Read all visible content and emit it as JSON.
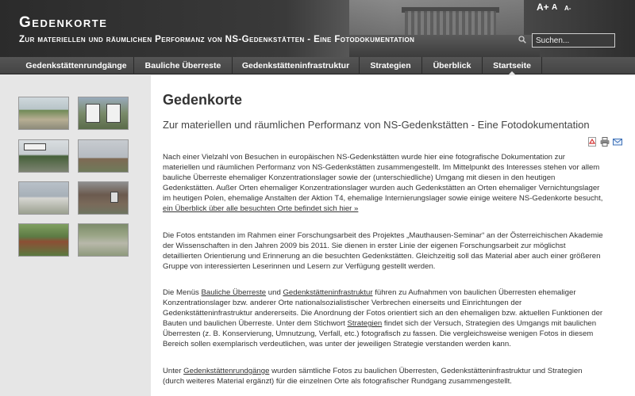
{
  "header": {
    "title": "Gedenkorte",
    "subtitle": "Zur materiellen und räumlichen Performanz von NS-Gedenkstätten - Eine Fotodokumentation",
    "font_size_controls": [
      "A+",
      "A",
      "A-"
    ],
    "search_placeholder": "Suchen..."
  },
  "nav": {
    "items": [
      {
        "label": "Gedenkstättenrundgänge",
        "active": false
      },
      {
        "label": "Bauliche Überreste",
        "active": false
      },
      {
        "label": "Gedenkstätteninfrastruktur",
        "active": false
      },
      {
        "label": "Strategien",
        "active": false
      },
      {
        "label": "Überblick",
        "active": false
      },
      {
        "label": "Startseite",
        "active": true
      }
    ]
  },
  "sidebar": {
    "thumbnails": [
      "photo-1",
      "photo-2",
      "photo-3",
      "photo-4",
      "photo-5",
      "photo-6",
      "photo-7",
      "photo-8"
    ]
  },
  "main": {
    "title": "Gedenkorte",
    "subtitle": "Zur materiellen und räumlichen Performanz von NS-Gedenkstätten - Eine Fotodokumentation",
    "tools": [
      "pdf-icon",
      "print-icon",
      "email-icon"
    ],
    "p1_text": "Nach einer Vielzahl von Besuchen in europäischen NS-Gedenkstätten wurde hier eine fotografische Dokumentation zur materiellen und räumlichen Performanz von NS-Gedenkstätten zusammengestellt. Im Mittelpunkt des Interesses stehen vor allem bauliche Überreste ehemaliger Konzentrationslager sowie der (unterschiedliche) Umgang mit diesen in den heutigen Gedenkstätten. Außer Orten ehemaliger Konzentrationslager wurden auch Gedenkstätten an Orten ehemaliger Vernichtungslager im heutigen Polen, ehemalige Anstalten der Aktion T4, ehemalige Internierungslager sowie einige weitere NS-Gedenkorte besucht, ",
    "p1_link": "ein Überblick über alle besuchten Orte befindet sich hier »",
    "p2_text": "Die Fotos entstanden im Rahmen einer Forschungsarbeit des Projektes „Mauthausen-Seminar“ an der Österreichischen Akademie der Wissenschaften in den Jahren 2009 bis 2011. Sie dienen in erster Linie der eigenen Forschungsarbeit zur möglichst detaillierten Orientierung und Erinnerung an die besuchten Gedenkstätten. Gleichzeitig soll das Material aber auch einer größeren Gruppe von interessierten Leserinnen und Lesern zur Verfügung gestellt werden.",
    "p3_a": "Die Menüs ",
    "p3_link1": "Bauliche Überreste",
    "p3_b": " und ",
    "p3_link2": "Gedenkstätteninfrastruktur",
    "p3_c": " führen zu Aufnahmen von baulichen Überresten ehemaliger Konzentrationslager bzw. anderer Orte nationalsozialistischer Verbrechen einerseits und Einrichtungen der Gedenkstätteninfrastruktur andererseits. Die Anordnung der Fotos orientiert sich an den ehemaligen bzw. aktuellen Funktionen der Bauten und baulichen Überreste. Unter dem Stichwort ",
    "p3_link3": "Strategien",
    "p3_d": " findet sich der Versuch, Strategien des Umgangs mit baulichen Überresten (z. B. Konservierung, Umnutzung, Verfall, etc.) fotografisch zu fassen. Die vergleichsweise wenigen Fotos in diesem Bereich sollen exemplarisch verdeutlichen, was unter der jeweiligen Strategie verstanden werden kann.",
    "p4_a": "Unter ",
    "p4_link": "Gedenkstättenrundgänge",
    "p4_b": " wurden sämtliche Fotos zu baulichen Überresten, Gedenkstätteninfrastruktur und Strategien (durch weiteres Material ergänzt) für die einzelnen Orte als fotografischer Rundgang zusammengestellt."
  },
  "colors": {
    "header_bg": "#3a3a3a",
    "nav_bg": "#4a4a4a",
    "sidebar_bg": "#e6e6e6",
    "content_bg": "#ffffff",
    "text": "#333333",
    "pdf_red": "#d32f2f",
    "mail_blue": "#3b6fb6"
  }
}
